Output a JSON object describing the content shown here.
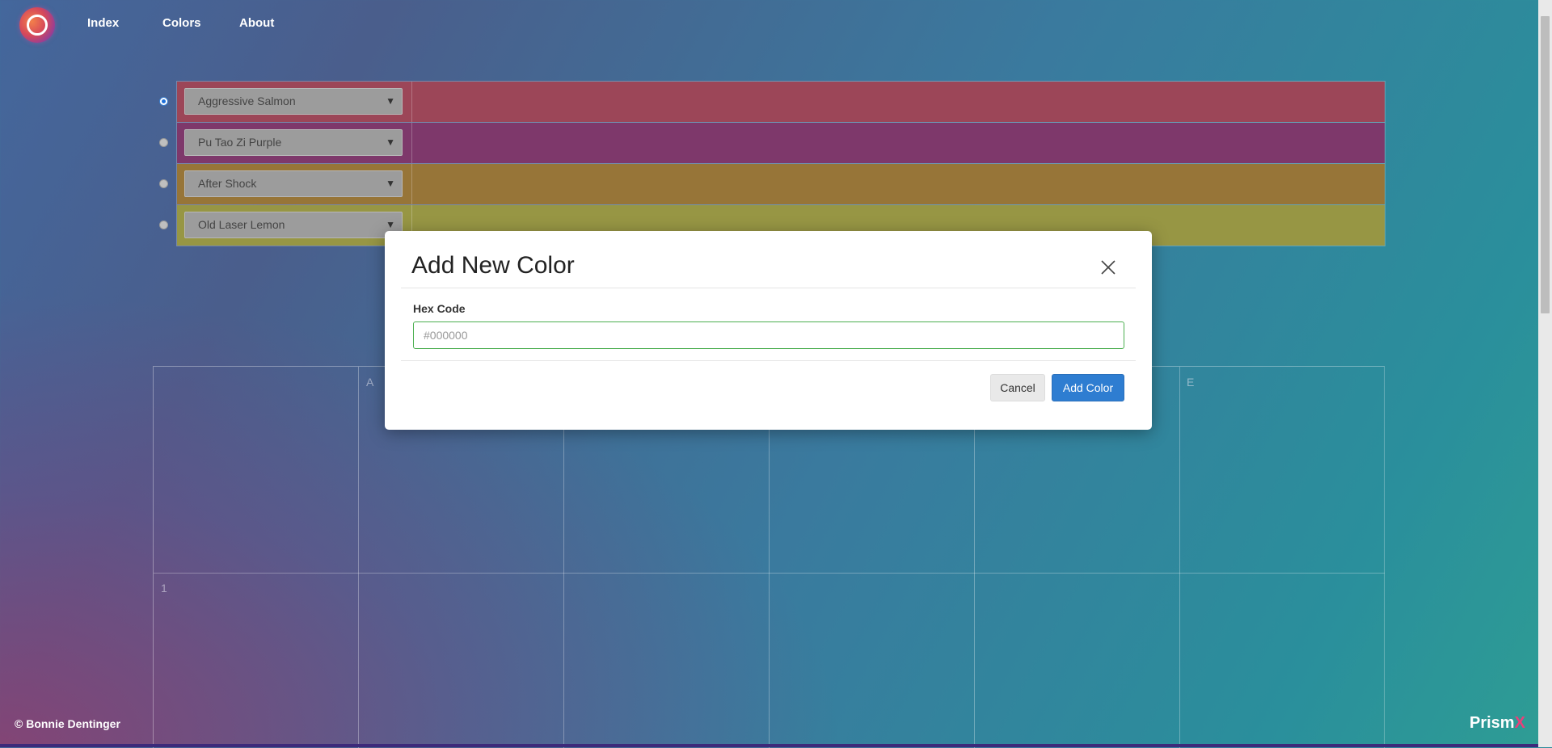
{
  "nav": {
    "links": [
      "Index",
      "Colors",
      "About"
    ]
  },
  "colors": [
    {
      "name": "Aggressive Salmon",
      "hex": "#9c4658",
      "selected": true
    },
    {
      "name": "Pu Tao Zi Purple",
      "hex": "#7e386b",
      "selected": false
    },
    {
      "name": "After Shock",
      "hex": "#977538",
      "selected": false
    },
    {
      "name": "Old Laser Lemon",
      "hex": "#979644",
      "selected": false
    }
  ],
  "grid": {
    "column_labels": [
      "A",
      "E"
    ],
    "row_labels": [
      "1"
    ]
  },
  "footer": {
    "copyright": "Bonnie Dentinger",
    "brand_main": "Prism",
    "brand_accent": "X"
  },
  "modal": {
    "title": "Add New Color",
    "field_label": "Hex Code",
    "field_placeholder": "#000000",
    "field_value": "",
    "cancel_label": "Cancel",
    "add_label": "Add Color"
  }
}
